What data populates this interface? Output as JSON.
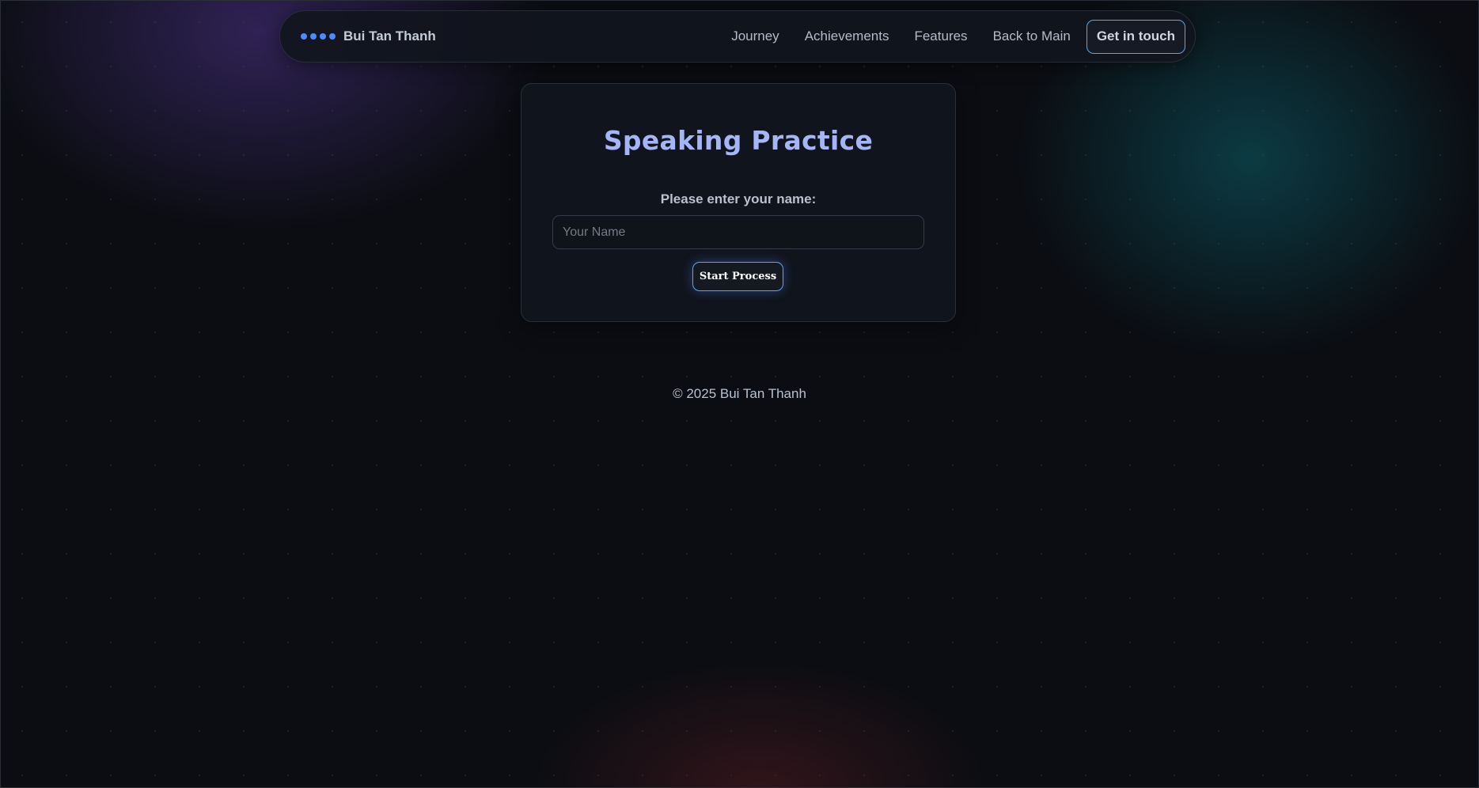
{
  "navbar": {
    "brand_name": "Bui Tan Thanh",
    "links": [
      "Journey",
      "Achievements",
      "Features",
      "Back to Main"
    ],
    "cta_label": "Get in touch",
    "brand_icon": "four-dots-logo"
  },
  "card": {
    "title": "Speaking Practice",
    "name_label": "Please enter your name:",
    "name_input": {
      "value": "",
      "placeholder": "Your Name"
    },
    "start_button_label": "Start Process"
  },
  "footer": {
    "copyright": "© 2025 Bui Tan Thanh"
  },
  "colors": {
    "background": "#0b0d12",
    "accent_blue": "#4a8cff",
    "title_color": "#a6b5f5",
    "button_border": "#5aa7e8"
  }
}
